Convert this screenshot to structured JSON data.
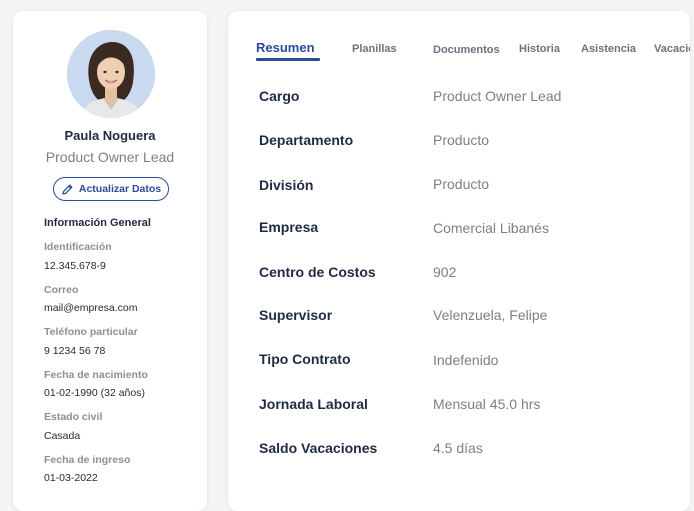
{
  "profile": {
    "name": "Paula Noguera",
    "role": "Product Owner Lead",
    "update_button": "Actualizar Datos",
    "info_title": "Información General",
    "fields": [
      {
        "label": "Identificación",
        "value": "12.345.678-9"
      },
      {
        "label": "Correo",
        "value": "mail@empresa.com"
      },
      {
        "label": "Teléfono particular",
        "value": "9 1234 56 78"
      },
      {
        "label": "Fecha de nacimiento",
        "value": "01-02-1990 (32 años)"
      },
      {
        "label": "Estado civil",
        "value": "Casada"
      },
      {
        "label": "Fecha de ingreso",
        "value": "01-03-2022"
      }
    ]
  },
  "tabs": [
    {
      "label": "Resumen",
      "active": true
    },
    {
      "label": "Planillas"
    },
    {
      "label": "Documentos"
    },
    {
      "label": "Historia"
    },
    {
      "label": "Asistencia"
    },
    {
      "label": "Vacaciones"
    }
  ],
  "summary": [
    {
      "label": "Cargo",
      "value": "Product Owner Lead"
    },
    {
      "label": "Departamento",
      "value": "Producto"
    },
    {
      "label": "División",
      "value": "Producto"
    },
    {
      "label": "Empresa",
      "value": "Comercial Libanés"
    },
    {
      "label": "Centro de Costos",
      "value": "902"
    },
    {
      "label": "Supervisor",
      "value": "Velenzuela, Felipe"
    },
    {
      "label": "Tipo Contrato",
      "value": "Indefenido"
    },
    {
      "label": "Jornada Laboral",
      "value": "Mensual 45.0 hrs"
    },
    {
      "label": "Saldo Vacaciones",
      "value": "4.5 días"
    }
  ],
  "icons": {
    "edit": "pencil-icon",
    "avatar": "avatar"
  },
  "colors": {
    "accent": "#2c4a9a",
    "background": "#f4f5f7",
    "card": "#ffffff",
    "muted_text": "#7a7f88"
  }
}
